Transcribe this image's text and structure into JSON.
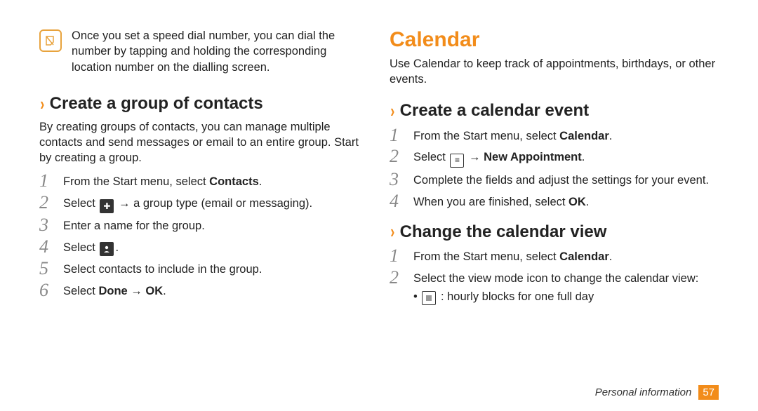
{
  "note": {
    "text": "Once you set a speed dial number, you can dial the number by tapping and holding the corresponding location number on the dialling screen."
  },
  "left": {
    "heading": "Create a group of contacts",
    "intro": "By creating groups of contacts, you can manage multiple contacts and send messages or email to an entire group. Start by creating a group.",
    "step1_a": "From the Start menu, select ",
    "step1_b": "Contacts",
    "step1_c": ".",
    "step2_a": "Select ",
    "step2_b": " → a group type (email or messaging).",
    "step3": "Enter a name for the group.",
    "step4_a": "Select ",
    "step4_b": ".",
    "step5": "Select contacts to include in the group.",
    "step6_a": "Select ",
    "step6_b": "Done",
    "step6_c": " → ",
    "step6_d": "OK",
    "step6_e": "."
  },
  "right": {
    "title": "Calendar",
    "intro": "Use Calendar to keep track of appointments, birthdays, or other events.",
    "sec1": {
      "heading": "Create a calendar event",
      "step1_a": "From the Start menu, select ",
      "step1_b": "Calendar",
      "step1_c": ".",
      "step2_a": "Select ",
      "step2_b": " → ",
      "step2_c": "New Appointment",
      "step2_d": ".",
      "step3": "Complete the fields and adjust the settings for your event.",
      "step4_a": "When you are finished, select ",
      "step4_b": "OK",
      "step4_c": "."
    },
    "sec2": {
      "heading": "Change the calendar view",
      "step1_a": "From the Start menu, select ",
      "step1_b": "Calendar",
      "step1_c": ".",
      "step2": "Select the view mode icon to change the calendar view:",
      "bullet_a": " : hourly blocks for one full day"
    }
  },
  "footer": {
    "section": "Personal information",
    "page": "57"
  }
}
